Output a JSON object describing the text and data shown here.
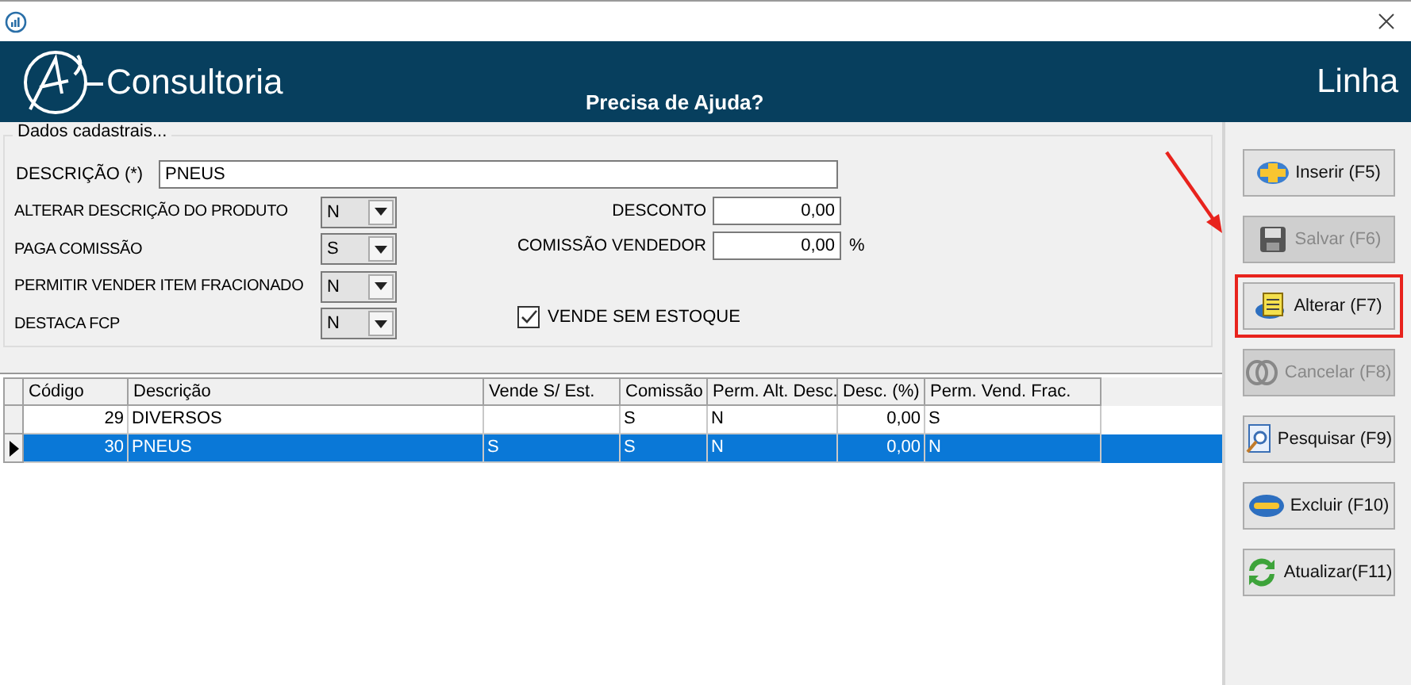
{
  "header": {
    "brand": "Consultoria",
    "help": "Precisa de Ajuda?",
    "title": "Linha"
  },
  "form": {
    "legend": "Dados cadastrais...",
    "description_label": "DESCRIÇÃO (*)",
    "description_value": "PNEUS",
    "selects": [
      {
        "label": "ALTERAR DESCRIÇÃO DO PRODUTO",
        "value": "N"
      },
      {
        "label": "PAGA COMISSÃO",
        "value": "S"
      },
      {
        "label": "PERMITIR VENDER ITEM FRACIONADO",
        "value": "N"
      },
      {
        "label": "DESTACA FCP",
        "value": "N"
      }
    ],
    "discount_label": "DESCONTO",
    "discount_value": "0,00",
    "commission_label": "COMISSÃO VENDEDOR",
    "commission_value": "0,00",
    "commission_unit": "%",
    "no_stock": {
      "label": "VENDE SEM ESTOQUE",
      "checked": true
    }
  },
  "table": {
    "columns": [
      "Código",
      "Descrição",
      "Vende S/ Est.",
      "Comissão",
      "Perm. Alt. Desc.",
      "Desc. (%)",
      "Perm. Vend. Frac."
    ],
    "rows": [
      {
        "selected": false,
        "cells": [
          "29",
          "DIVERSOS",
          "",
          "S",
          "N",
          "0,00",
          "S"
        ]
      },
      {
        "selected": true,
        "cells": [
          "30",
          "PNEUS",
          "S",
          "S",
          "N",
          "0,00",
          "N"
        ]
      }
    ]
  },
  "buttons": [
    {
      "label": "Inserir (F5)",
      "disabled": false,
      "highlighted": false
    },
    {
      "label": "Salvar (F6)",
      "disabled": true,
      "highlighted": false
    },
    {
      "label": "Alterar (F7)",
      "disabled": false,
      "highlighted": true
    },
    {
      "label": "Cancelar (F8)",
      "disabled": true,
      "highlighted": false
    },
    {
      "label": "Pesquisar (F9)",
      "disabled": false,
      "highlighted": false
    },
    {
      "label": "Excluir (F10)",
      "disabled": false,
      "highlighted": false
    },
    {
      "label": "Atualizar(F11)",
      "disabled": false,
      "highlighted": false
    }
  ]
}
